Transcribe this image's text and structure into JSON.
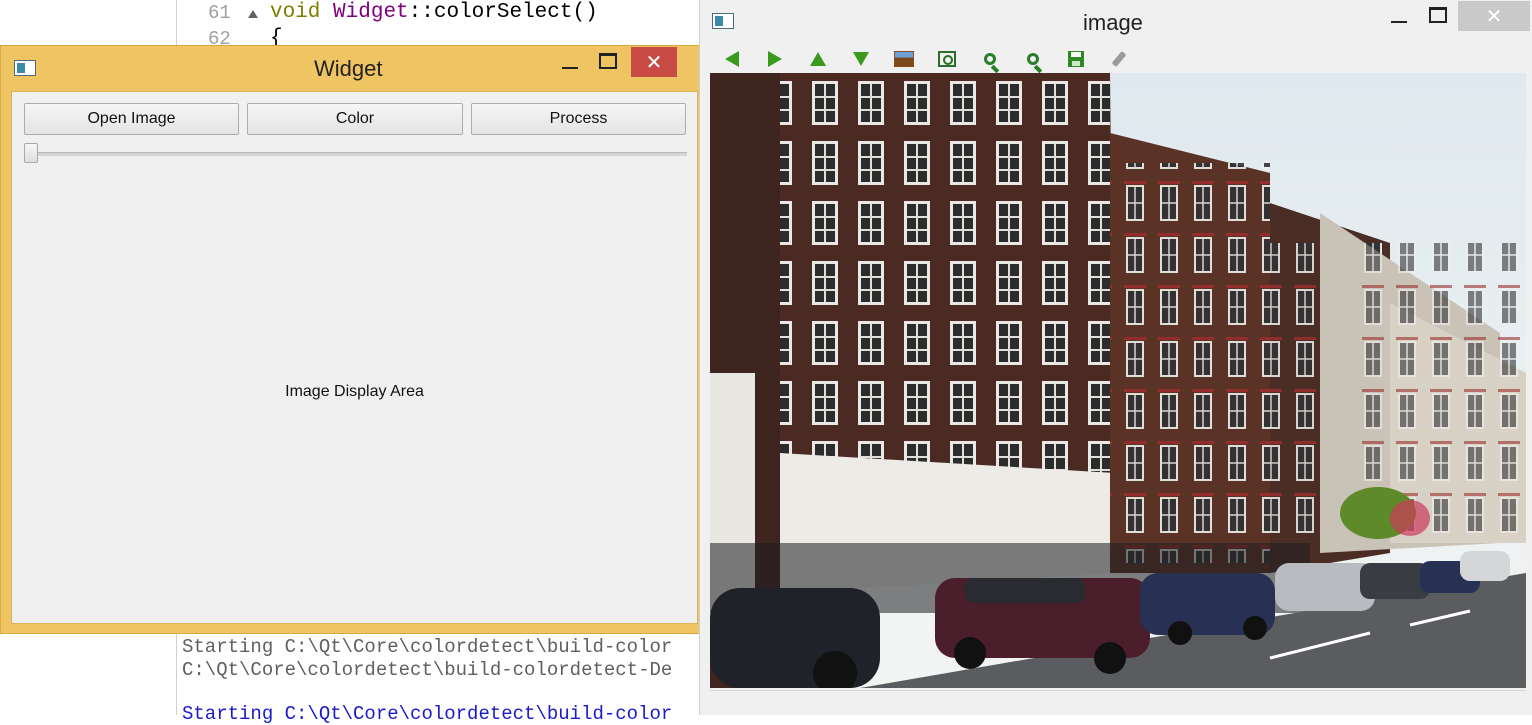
{
  "editor": {
    "line_numbers": [
      "61",
      "62"
    ],
    "code_line_61": {
      "kw": "void",
      "cls": "Widget",
      "rest": "::colorSelect()"
    },
    "code_line_62": "{",
    "output_lines": [
      "Starting C:\\Qt\\Core\\colordetect\\build-color",
      "C:\\Qt\\Core\\colordetect\\build-colordetect-De",
      "Starting C:\\Qt\\Core\\colordetect\\build-color"
    ]
  },
  "widget_window": {
    "title": "Widget",
    "buttons": {
      "open_image": "Open Image",
      "color": "Color",
      "process": "Process"
    },
    "slider_value": 0,
    "display_area_text": "Image Display Area",
    "close_glyph": "✕"
  },
  "image_window": {
    "title": "image",
    "close_glyph": "✕",
    "toolbar_icons": [
      "arrow-left-icon",
      "arrow-right-icon",
      "arrow-up-icon",
      "arrow-down-icon",
      "picture-icon",
      "zoom-fit-icon",
      "zoom-in-icon",
      "zoom-out-icon",
      "save-icon",
      "brush-icon"
    ]
  },
  "colors": {
    "active_title": "#efc462",
    "close_red": "#c74a44",
    "toolbar_green": "#3a9a1c"
  }
}
